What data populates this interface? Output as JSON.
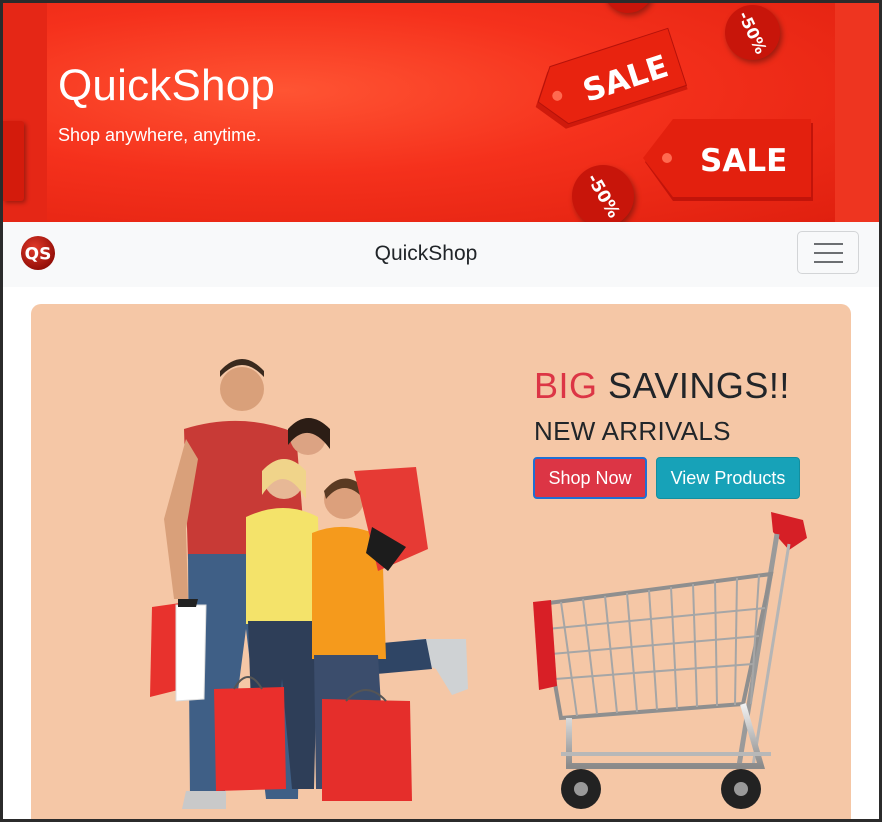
{
  "banner": {
    "title": "QuickShop",
    "subtitle": "Shop anywhere, anytime.",
    "tags": [
      "SALE",
      "SALE"
    ],
    "discounts": [
      "-50%",
      "-50%"
    ]
  },
  "navbar": {
    "logo_text": "QS",
    "title": "QuickShop",
    "menu_icon": "hamburger-icon"
  },
  "hero": {
    "headline_highlight": "BIG",
    "headline_rest": " SAVINGS!!",
    "subheadline": "NEW ARRIVALS",
    "primary_button": "Shop Now",
    "secondary_button": "View Products"
  },
  "colors": {
    "banner_red": "#e8281a",
    "hero_bg": "#f5c7a6",
    "accent_red": "#dc3545",
    "accent_teal": "#17a2b8"
  }
}
